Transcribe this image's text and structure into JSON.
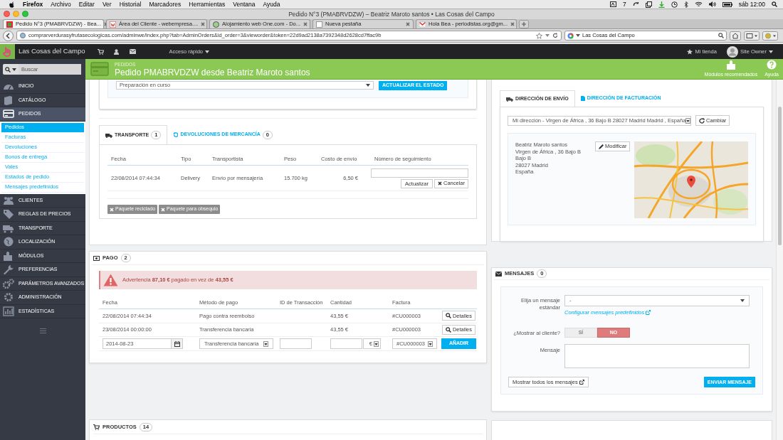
{
  "menu_bar": {
    "app": "Firefox",
    "items": [
      "Archivo",
      "Editar",
      "Ver",
      "Historial",
      "Marcadores",
      "Herramientas",
      "Ventana",
      "Ayuda"
    ],
    "indicator": "7",
    "clock": "sáb 12:00"
  },
  "window": {
    "title": "Pedido N°3 (PMABRVDZW) – Beatriz Maroto santos • Las Cosas del Campo"
  },
  "browser_tabs": [
    {
      "label": "Pedido N°3 (PMABRVDZW) - Bea...",
      "selected": true
    },
    {
      "label": "Área del Cliente - webempresa....",
      "selected": false
    },
    {
      "label": "Alojamiento web One.com - Do...",
      "selected": false
    },
    {
      "label": "Nueva pestaña",
      "selected": false
    },
    {
      "label": "Hola Bea - periodistas.org@gm...",
      "selected": false
    }
  ],
  "address_bar": {
    "url": "comprarverdurasyfrutasecologicas.com/adminwe/index.php?tab=AdminOrders&id_order=3&vieworder&token=22d9ad2138a7392348d2628cd7ffac9b",
    "search": "Las Cosas del Campo"
  },
  "admin_bar": {
    "shop": "Las Cosas del Campo",
    "quick_access": "Acceso rápido",
    "my_shop": "Mi tienda",
    "user": "Site Owner"
  },
  "search": {
    "placeholder": "Buscar"
  },
  "sidebar": {
    "items": [
      {
        "label": "INICIO",
        "selected": false
      },
      {
        "label": "CATÁLOGO",
        "selected": false
      },
      {
        "label": "PEDIDOS",
        "selected": true,
        "children": [
          {
            "label": "Pedidos",
            "selected": true
          },
          {
            "label": "Facturas",
            "selected": false
          },
          {
            "label": "Devoluciones",
            "selected": false
          },
          {
            "label": "Bonos de entrega",
            "selected": false
          },
          {
            "label": "Vales",
            "selected": false
          },
          {
            "label": "Estados de pedido",
            "selected": false
          },
          {
            "label": "Mensajes predefinidos",
            "selected": false
          }
        ]
      },
      {
        "label": "CLIENTES",
        "selected": false
      },
      {
        "label": "REGLAS DE PRECIOS",
        "selected": false
      },
      {
        "label": "TRANSPORTE",
        "selected": false
      },
      {
        "label": "LOCALIZACIÓN",
        "selected": false
      },
      {
        "label": "MÓDULOS",
        "selected": false
      },
      {
        "label": "PREFERENCIAS",
        "selected": false
      },
      {
        "label": "PARÁMETROS AVANZADOS",
        "selected": false
      },
      {
        "label": "ADMINISTRACIÓN",
        "selected": false
      },
      {
        "label": "ESTADÍSTICAS",
        "selected": false
      }
    ]
  },
  "page_header": {
    "breadcrumb": "PEDIDOS",
    "title": "Pedido PMABRVDZW desde Beatriz Maroto santos",
    "actions": [
      "Módulos recomendados",
      "Ayuda"
    ]
  },
  "status": {
    "value": "Preparación en curso",
    "button": "ACTUALIZAR EL ESTADO"
  },
  "shipping_tabs": [
    {
      "label": "TRANSPORTE",
      "count": "1",
      "selected": true
    },
    {
      "label": "DEVOLUCIONES DE MERCANCÍA",
      "count": "0",
      "selected": false
    }
  ],
  "shipping_table": {
    "columns": [
      "Fecha",
      "Tipo",
      "Transportista",
      "Peso",
      "Costo de envío",
      "Número de seguimiento"
    ],
    "rows": [
      {
        "cells": [
          "22/08/2014 07:44:34",
          "Delivery",
          "Envío por mensajería",
          "15.700 kg",
          "6,50 €"
        ]
      }
    ],
    "buttons": [
      "Actualizar",
      "Cancelar"
    ]
  },
  "package_buttons": [
    "Paquete reciclado",
    "Paquete para obsequio"
  ],
  "payment": {
    "title": "PAGO",
    "count": "2",
    "warning": "Advertencia **87,10 €** pagado en vez de **43,55 €**",
    "columns": [
      "Fecha",
      "Método de pago",
      "ID de Transacción",
      "Cantidad",
      "Factura"
    ],
    "rows": [
      {
        "cells": [
          "22/08/2014 07:44:34",
          "Pago contra reembolso",
          "",
          "43,55 €",
          "#CU000003"
        ],
        "button": "Detalles"
      },
      {
        "cells": [
          "23/08/2014 00:00:00",
          "Transferencia bancaria",
          "",
          "43,55 €",
          "#CU000003"
        ],
        "button": "Detalles"
      }
    ],
    "form": {
      "date": "2014-08-23",
      "method": "Transferencia bancaria",
      "currency": "€",
      "invoice": "#CU000003",
      "button": "AÑADIR"
    }
  },
  "products": {
    "title": "PRODUCTOS",
    "count": "14"
  },
  "address_tabs": [
    {
      "label": "DIRECCIÓN DE ENVÍO",
      "selected": true
    },
    {
      "label": "DIRECCIÓN DE FACTURACIÓN",
      "selected": false
    }
  ],
  "address": {
    "select": "Mi dirección - Virgen de África , 36 Bajo B 28027 Madrid Madrid , España",
    "change": "Cambiar",
    "lines": [
      "Beatriz Maroto santos",
      "Virgen de África , 36 Bajo B",
      "Bajo B",
      "28027 Madrid",
      "España"
    ],
    "edit": "Modificar"
  },
  "messages": {
    "title": "MENSAJES",
    "count": "0",
    "standard_label": "Elija un mensaje estándar",
    "standard_value": "-",
    "config_link": "Configurar mensajes predefinidos",
    "show_label": "¿Mostrar al cliente?",
    "toggle": [
      {
        "label": "SÍ",
        "selected": false
      },
      {
        "label": "NO",
        "selected": true
      }
    ],
    "message_label": "Mensaje",
    "show_all": "Mostrar todos los mensajes",
    "send": "ENVIAR MENSAJE"
  }
}
